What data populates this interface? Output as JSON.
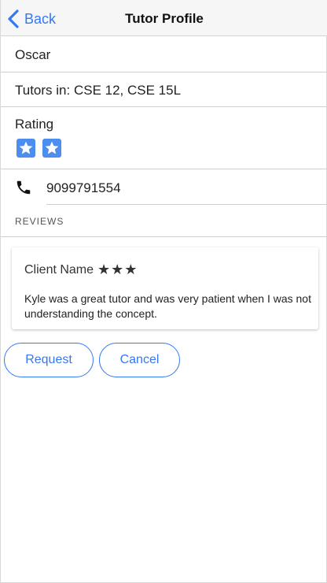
{
  "nav": {
    "back_label": "Back",
    "title": "Tutor Profile"
  },
  "profile": {
    "name": "Oscar",
    "tutors_in": "Tutors in: CSE 12, CSE 15L",
    "rating_label": "Rating",
    "rating_stars": 2,
    "phone": "9099791554"
  },
  "reviews": {
    "section_label": "REVIEWS",
    "items": [
      {
        "client_name": "Client Name",
        "stars": "★★★",
        "text": "Kyle was a great tutor and was very patient when I was not understanding the concept."
      }
    ]
  },
  "actions": {
    "request_label": "Request",
    "cancel_label": "Cancel"
  },
  "colors": {
    "accent": "#3478f6",
    "star_box": "#4d8df0"
  },
  "icons": {
    "back": "chevron-left-icon",
    "star": "star-icon",
    "phone": "phone-icon"
  }
}
